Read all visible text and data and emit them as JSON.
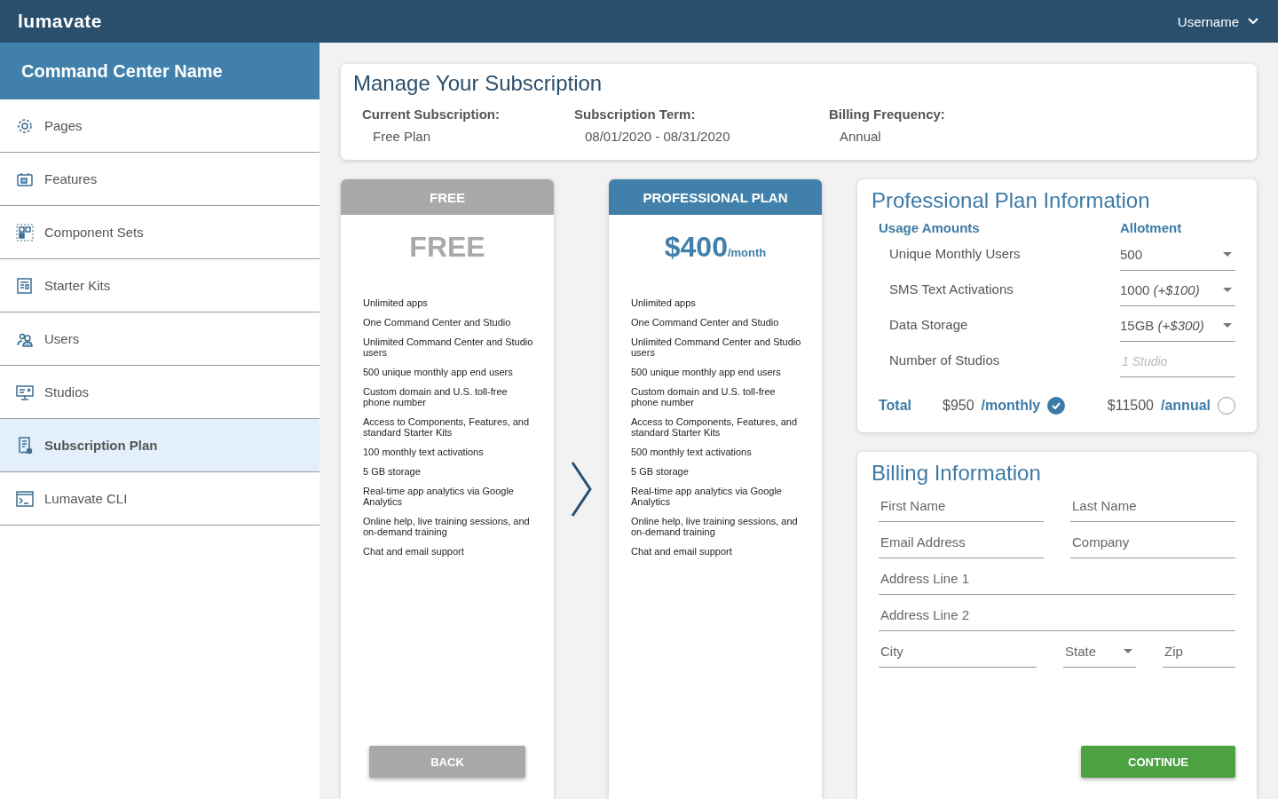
{
  "header": {
    "logo": "lumavate",
    "user": "Username"
  },
  "sidebar": {
    "title": "Command Center Name",
    "items": [
      {
        "label": "Pages",
        "kind": "gear",
        "selected": false
      },
      {
        "label": "Features",
        "kind": "feature",
        "selected": false
      },
      {
        "label": "Component Sets",
        "kind": "grid",
        "selected": false
      },
      {
        "label": "Starter Kits",
        "kind": "kit",
        "selected": false
      },
      {
        "label": "Users",
        "kind": "users",
        "selected": false
      },
      {
        "label": "Studios",
        "kind": "monitor",
        "selected": false
      },
      {
        "label": "Subscription Plan",
        "kind": "receipt",
        "selected": true
      },
      {
        "label": "Lumavate CLI",
        "kind": "terminal",
        "selected": false
      }
    ]
  },
  "subscription": {
    "title": "Manage Your Subscription",
    "fields": [
      {
        "label": "Current Subscription:",
        "value": "Free Plan"
      },
      {
        "label": "Subscription Term:",
        "value": "08/01/2020 - 08/31/2020"
      },
      {
        "label": "Billing Frequency:",
        "value": "Annual"
      }
    ]
  },
  "plans": [
    {
      "kind": "free",
      "header": "FREE",
      "price": "FREE",
      "features": [
        "Unlimited apps",
        "One Command Center and Studio",
        "Unlimited Command Center and Studio users",
        "500 unique monthly app end users",
        "Custom domain and U.S. toll-free phone number",
        "Access to Components, Features, and standard Starter Kits",
        "100 monthly text activations",
        "5 GB storage",
        "Real-time app analytics via Google Analytics",
        "Online help, live training sessions, and on-demand training",
        "Chat and email support"
      ],
      "button": "BACK"
    },
    {
      "kind": "pro",
      "header": "PROFESSIONAL PLAN",
      "price": "$400",
      "per": "/month",
      "features": [
        "Unlimited apps",
        "One Command Center and Studio",
        "Unlimited Command Center and Studio users",
        "500 unique monthly app end users",
        "Custom domain and U.S. toll-free phone number",
        "Access to Components, Features, and standard Starter Kits",
        "500 monthly text activations",
        "5 GB storage",
        "Real-time app analytics via Google Analytics",
        "Online help, live training sessions, and on-demand training",
        "Chat and email support"
      ]
    }
  ],
  "plan_info": {
    "title": "Professional Plan Information",
    "col_usage": "Usage Amounts",
    "col_allotment": "Allotment",
    "rows": [
      {
        "label": "Unique Monthly Users",
        "value": "500",
        "kind": "select"
      },
      {
        "label": "SMS Text Activations",
        "value": "1000 *(+$100)*",
        "kind": "select"
      },
      {
        "label": "Data Storage",
        "value": "15GB *(+$300)*",
        "kind": "select"
      },
      {
        "label": "Number of Studios",
        "placeholder": "1 Studio",
        "kind": "input"
      }
    ],
    "total_label": "Total",
    "options": [
      {
        "amount": "$950",
        "period": "/monthly",
        "selected": true
      },
      {
        "amount": "$11500",
        "period": "/annual",
        "selected": false
      }
    ]
  },
  "billing": {
    "title": "Billing Information",
    "rows": [
      [
        {
          "placeholder": "First Name",
          "kind": "input"
        },
        {
          "placeholder": "Last Name",
          "kind": "input"
        }
      ],
      [
        {
          "placeholder": "Email Address",
          "kind": "input"
        },
        {
          "placeholder": "Company",
          "kind": "input"
        }
      ],
      [
        {
          "placeholder": "Address Line 1",
          "kind": "input"
        }
      ],
      [
        {
          "placeholder": "Address Line 2",
          "kind": "input"
        }
      ],
      [
        {
          "placeholder": "City",
          "kind": "input"
        },
        {
          "placeholder": "State",
          "kind": "select"
        },
        {
          "placeholder": "Zip",
          "kind": "input"
        }
      ]
    ],
    "button": "CONTINUE"
  }
}
